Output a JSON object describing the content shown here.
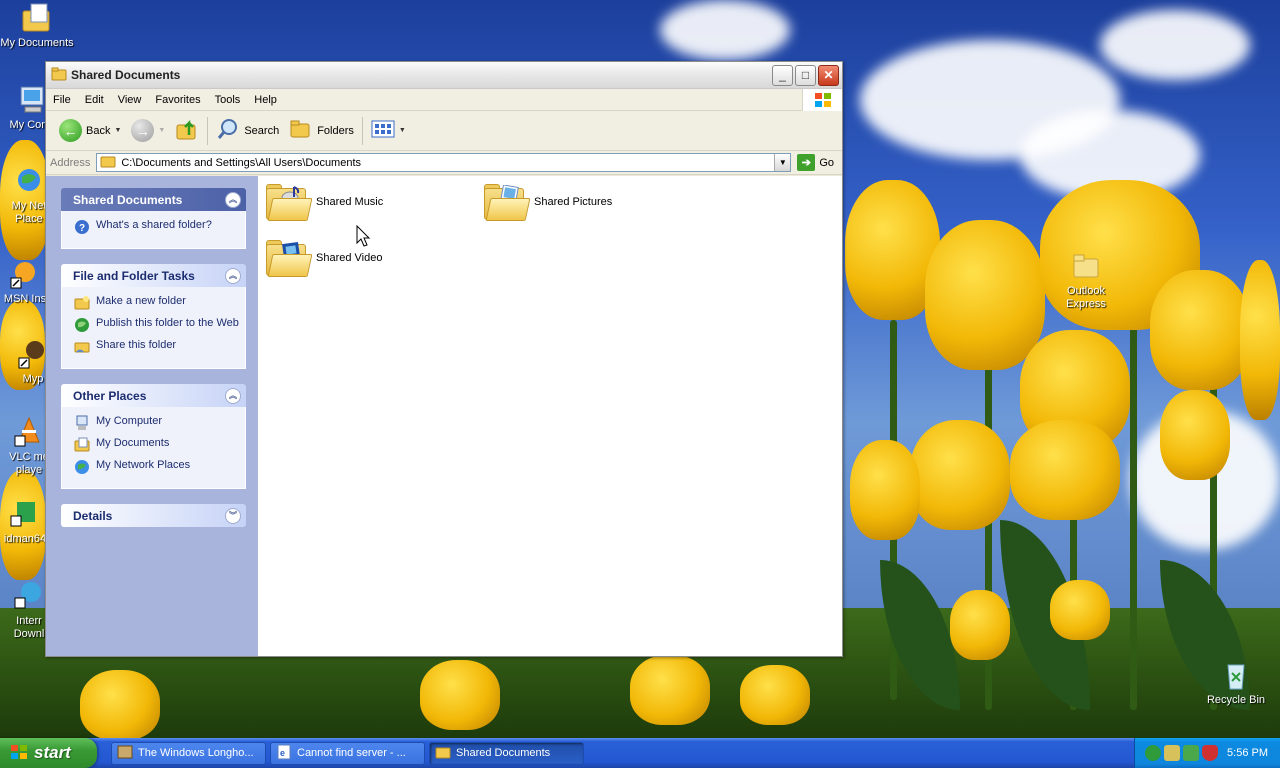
{
  "desktop": {
    "icons": [
      {
        "label": "My Documents"
      },
      {
        "label": "My Comp"
      },
      {
        "label": "My Net\nPlace"
      },
      {
        "label": "MSN Ins"
      },
      {
        "label": "Myp"
      },
      {
        "label": "VLC me\nplaye"
      },
      {
        "label": "idman64"
      },
      {
        "label": "Interr\nDownl"
      },
      {
        "label": "Outlook\nExpress"
      },
      {
        "label": "Recycle Bin"
      }
    ]
  },
  "window": {
    "title": "Shared Documents",
    "menu": [
      "File",
      "Edit",
      "View",
      "Favorites",
      "Tools",
      "Help"
    ],
    "toolbar": {
      "back_label": "Back",
      "search_label": "Search",
      "folders_label": "Folders"
    },
    "address": {
      "label": "Address",
      "value": "C:\\Documents and Settings\\All Users\\Documents",
      "go_label": "Go"
    },
    "taskpane": {
      "shared": {
        "title": "Shared Documents",
        "items": [
          "What's a shared folder?"
        ]
      },
      "tasks": {
        "title": "File and Folder Tasks",
        "items": [
          "Make a new folder",
          "Publish this folder to the Web",
          "Share this folder"
        ]
      },
      "places": {
        "title": "Other Places",
        "items": [
          "My Computer",
          "My Documents",
          "My Network Places"
        ]
      },
      "details": {
        "title": "Details"
      }
    },
    "files": [
      {
        "name": "Shared Music",
        "icon": "music-note-icon"
      },
      {
        "name": "Shared Pictures",
        "icon": "picture-icon"
      },
      {
        "name": "Shared Video",
        "icon": "film-icon"
      }
    ]
  },
  "taskbar": {
    "start_label": "start",
    "buttons": [
      {
        "label": "The Windows Longho..."
      },
      {
        "label": "Cannot find server - ..."
      },
      {
        "label": "Shared Documents"
      }
    ],
    "clock": "5:56 PM"
  },
  "colors": {
    "taskbar_blue": "#2457d1",
    "start_green": "#3a9a35",
    "taskpane_bg": "#a8b4dc",
    "panel_title": "#1c3f94"
  }
}
